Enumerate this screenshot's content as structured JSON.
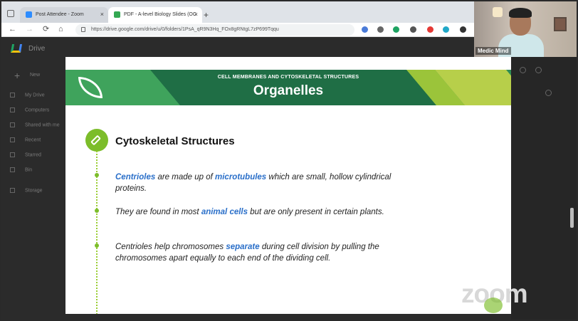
{
  "browser": {
    "tabs": [
      {
        "label": "Post Attendee - Zoom",
        "color": "#2d8cff"
      },
      {
        "label": "PDF - A-level Biology Slides (OC",
        "color": "#34a853"
      }
    ],
    "new_tab": "+",
    "url": "https://drive.google.com/drive/u/0/folders/1PsA_qR9N3Hq_FOx8gRNtgL7zP699Tqqu",
    "nav": {
      "back": "←",
      "forward": "→",
      "reload": "⟳",
      "home": "⌂"
    }
  },
  "drive": {
    "title": "Drive",
    "new_label": "New",
    "sidebar": [
      "My Drive",
      "Computers",
      "Shared with me",
      "Recent",
      "Starred",
      "Bin",
      "Storage"
    ]
  },
  "video": {
    "participant_name": "Medic Mind"
  },
  "slide": {
    "subtitle": "CELL MEMBRANES AND CYTOSKELETAL STRUCTURES",
    "title": "Organelles",
    "heading": "Cytoskeletal Structures",
    "bullets": [
      {
        "parts": [
          {
            "t": "Centrioles",
            "hl": true
          },
          {
            "t": " are made up of "
          },
          {
            "t": "microtubules",
            "hl": true
          },
          {
            "t": " which are small, hollow cylindrical proteins."
          }
        ]
      },
      {
        "parts": [
          {
            "t": "They are found in most "
          },
          {
            "t": "animal cells",
            "hl": true
          },
          {
            "t": " but are only present in certain plants."
          }
        ]
      },
      {
        "parts": [
          {
            "t": "Centrioles help chromosomes "
          },
          {
            "t": "separate",
            "hl": true
          },
          {
            "t": " during cell division by pulling the chromosomes apart equally to each end of the dividing cell."
          }
        ]
      }
    ]
  },
  "watermark": "zoom",
  "colors": {
    "accent_green": "#7cbd2a",
    "highlight_blue": "#2a6fc9",
    "banner_green": "#2e8b57"
  }
}
